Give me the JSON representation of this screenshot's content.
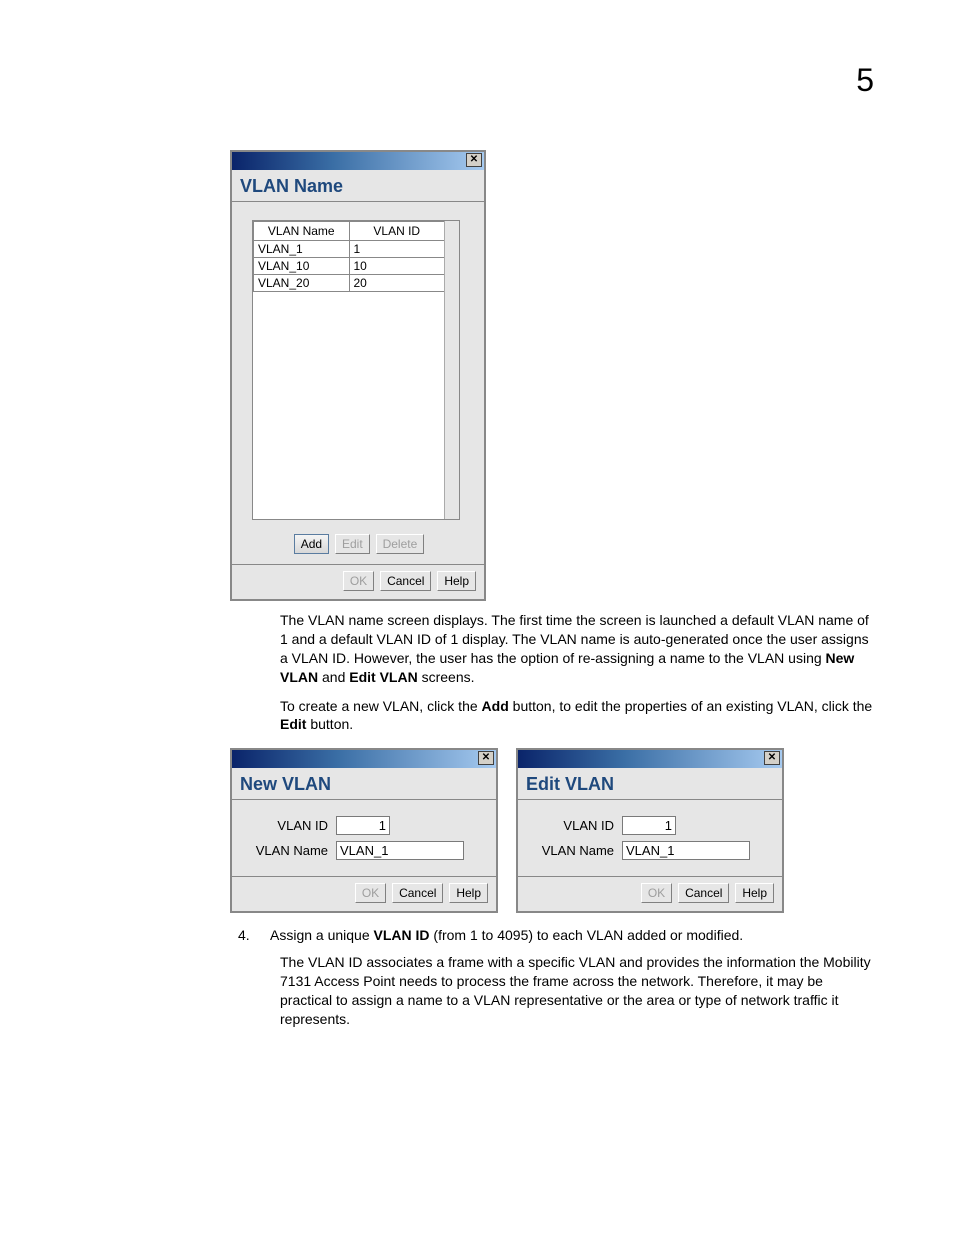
{
  "page_number": "5",
  "vlan_name_dialog": {
    "title": "VLAN Name",
    "columns": {
      "name": "VLAN Name",
      "id": "VLAN ID"
    },
    "rows": [
      {
        "name": "VLAN_1",
        "id": "1"
      },
      {
        "name": "VLAN_10",
        "id": "10"
      },
      {
        "name": "VLAN_20",
        "id": "20"
      }
    ],
    "buttons": {
      "add": "Add",
      "edit": "Edit",
      "delete": "Delete"
    },
    "footer": {
      "ok": "OK",
      "cancel": "Cancel",
      "help": "Help"
    }
  },
  "para1_a": "The VLAN name screen displays. The first time the screen is launched a default VLAN name of 1 and a default VLAN ID of 1 display. The VLAN name is auto-generated once the user assigns a VLAN ID. However, the user has the option of re-assigning a name to the VLAN using ",
  "para1_b": " and ",
  "para1_c": " screens.",
  "para1_bold1": "New VLAN",
  "para1_bold2": "Edit VLAN",
  "para2_a": "To create a new VLAN, click the ",
  "para2_b": " button, to edit the properties of an existing VLAN, click the ",
  "para2_c": " button.",
  "para2_bold1": "Add",
  "para2_bold2": "Edit",
  "new_vlan_dialog": {
    "title": "New VLAN",
    "labels": {
      "id": "VLAN ID",
      "name": "VLAN Name"
    },
    "values": {
      "id": "1",
      "name": "VLAN_1"
    },
    "footer": {
      "ok": "OK",
      "cancel": "Cancel",
      "help": "Help"
    }
  },
  "edit_vlan_dialog": {
    "title": "Edit VLAN",
    "labels": {
      "id": "VLAN ID",
      "name": "VLAN Name"
    },
    "values": {
      "id": "1",
      "name": "VLAN_1"
    },
    "footer": {
      "ok": "OK",
      "cancel": "Cancel",
      "help": "Help"
    }
  },
  "step4": {
    "num": "4.",
    "text_a": "Assign a unique ",
    "text_b": " (from 1 to 4095) to each VLAN added or modified.",
    "bold": "VLAN ID"
  },
  "para3": "The VLAN ID associates a frame with a specific VLAN and provides the information the Mobility 7131 Access Point needs to process the frame across the network. Therefore, it may be practical to assign a name to a VLAN representative or the area or type of network traffic it represents."
}
